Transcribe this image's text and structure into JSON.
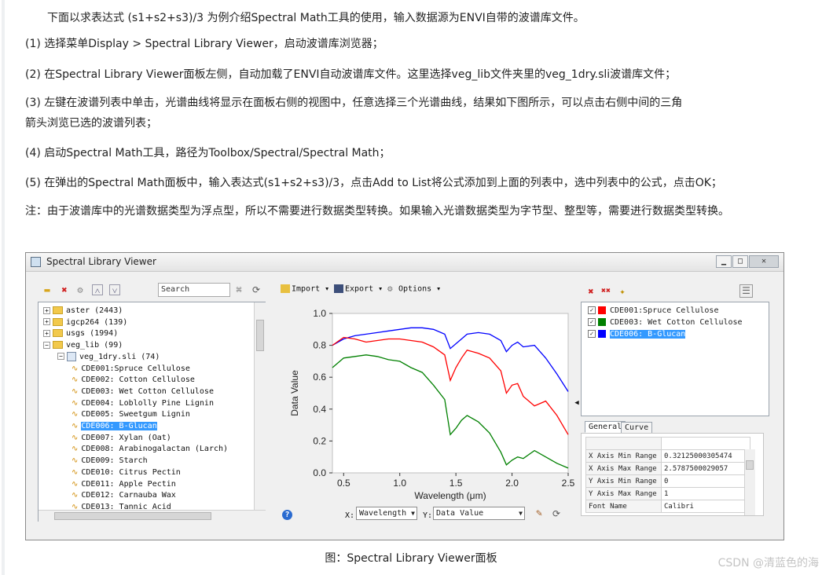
{
  "doc": {
    "intro": "下面以求表达式 (s1+s2+s3)/3 为例介绍Spectral Math工具的使用，输入数据源为ENVI自带的波谱库文件。",
    "step1": "(1) 选择菜单Display > Spectral Library Viewer，启动波谱库浏览器；",
    "step2": "(2) 在Spectral Library Viewer面板左侧，自动加载了ENVI自动波谱库文件。这里选择veg_lib文件夹里的veg_1dry.sli波谱库文件；",
    "step3a": "(3) 左键在波谱列表中单击，光谱曲线将显示在面板右侧的视图中，任意选择三个光谱曲线，结果如下图所示，可以点击右侧中间的三角",
    "step3b": "箭头浏览已选的波谱列表；",
    "step4": "(4) 启动Spectral Math工具，路径为Toolbox/Spectral/Spectral Math；",
    "step5": "(5) 在弹出的Spectral Math面板中，输入表达式(s1+s2+s3)/3，点击Add to List将公式添加到上面的列表中，选中列表中的公式，点击OK；",
    "note": "注：由于波谱库中的光谱数据类型为浮点型，所以不需要进行数据类型转换。如果输入光谱数据类型为字节型、整型等，需要进行数据类型转换。",
    "caption": "图：Spectral Library Viewer面板",
    "watermark": "CSDN @清蓝色的海"
  },
  "window": {
    "title": "Spectral Library Viewer",
    "search_placeholder": "Search",
    "tree": [
      {
        "label": "aster  (2443)",
        "level": 0,
        "type": "folder",
        "expander": "+"
      },
      {
        "label": "igcp264  (139)",
        "level": 0,
        "type": "folder",
        "expander": "+"
      },
      {
        "label": "usgs  (1994)",
        "level": 0,
        "type": "folder",
        "expander": "+"
      },
      {
        "label": "veg_lib  (99)",
        "level": 0,
        "type": "folder",
        "expander": "−"
      },
      {
        "label": "veg_1dry.sli  (74)",
        "level": 1,
        "type": "speclib",
        "expander": "−"
      },
      {
        "label": "CDE001:Spruce Cellulose",
        "level": 2,
        "type": "spectrum"
      },
      {
        "label": "CDE002: Cotton Cellulose",
        "level": 2,
        "type": "spectrum"
      },
      {
        "label": "CDE003: Wet Cotton Cellulose",
        "level": 2,
        "type": "spectrum"
      },
      {
        "label": "CDE004: Loblolly Pine Lignin",
        "level": 2,
        "type": "spectrum"
      },
      {
        "label": "CDE005: Sweetgum Lignin",
        "level": 2,
        "type": "spectrum"
      },
      {
        "label": "CDE006: B-Glucan",
        "level": 2,
        "type": "spectrum",
        "selected": true
      },
      {
        "label": "CDE007: Xylan (Oat)",
        "level": 2,
        "type": "spectrum"
      },
      {
        "label": "CDE008: Arabinogalactan (Larch)",
        "level": 2,
        "type": "spectrum"
      },
      {
        "label": "CDE009: Starch",
        "level": 2,
        "type": "spectrum"
      },
      {
        "label": "CDE010: Citrus Pectin",
        "level": 2,
        "type": "spectrum"
      },
      {
        "label": "CDE011: Apple Pectin",
        "level": 2,
        "type": "spectrum"
      },
      {
        "label": "CDE012: Carnauba Wax",
        "level": 2,
        "type": "spectrum"
      },
      {
        "label": "CDE013: Tannic Acid",
        "level": 2,
        "type": "spectrum"
      }
    ],
    "menus": {
      "import": "Import",
      "export": "Export",
      "options": "Options"
    },
    "x_label": "X:",
    "x_value": "Wavelength",
    "y_label": "Y:",
    "y_value": "Data Value",
    "legend": [
      {
        "label": "CDE001:Spruce Cellulose",
        "color": "#ff0000"
      },
      {
        "label": "CDE003: Wet Cotton Cellulose",
        "color": "#008000"
      },
      {
        "label": "CDE006: B-Glucan",
        "color": "#0000ff",
        "selected": true
      }
    ],
    "tabs": {
      "general": "General",
      "curve": "Curve"
    },
    "properties": [
      {
        "key": "X Axis Min Range",
        "value": "0.32125000305474"
      },
      {
        "key": "X Axis Max Range",
        "value": "2.5787500029057"
      },
      {
        "key": "Y Axis Min Range",
        "value": "0"
      },
      {
        "key": "Y Axis Max Range",
        "value": "1"
      },
      {
        "key": "Font Name",
        "value": "Calibri"
      }
    ]
  },
  "chart_data": {
    "type": "line",
    "xlabel": "Wavelength (μm)",
    "ylabel": "Data Value",
    "xlim": [
      0.4,
      2.5
    ],
    "ylim": [
      0.0,
      1.0
    ],
    "xticks": [
      "0.5",
      "1.0",
      "1.5",
      "2.0",
      "2.5"
    ],
    "yticks": [
      "0.0",
      "0.2",
      "0.4",
      "0.6",
      "0.8",
      "1.0"
    ],
    "grid": false,
    "series": [
      {
        "color": "#0000ff",
        "x": [
          0.4,
          0.5,
          0.6,
          0.7,
          0.8,
          0.9,
          1.0,
          1.1,
          1.2,
          1.3,
          1.4,
          1.45,
          1.5,
          1.55,
          1.6,
          1.7,
          1.8,
          1.9,
          1.95,
          2.0,
          2.05,
          2.1,
          2.2,
          2.3,
          2.4,
          2.5
        ],
        "y": [
          0.8,
          0.84,
          0.86,
          0.87,
          0.88,
          0.89,
          0.9,
          0.91,
          0.91,
          0.9,
          0.87,
          0.78,
          0.81,
          0.84,
          0.87,
          0.88,
          0.87,
          0.83,
          0.76,
          0.8,
          0.82,
          0.79,
          0.8,
          0.72,
          0.62,
          0.51
        ]
      },
      {
        "color": "#ff0000",
        "x": [
          0.4,
          0.5,
          0.6,
          0.7,
          0.8,
          0.9,
          1.0,
          1.1,
          1.2,
          1.3,
          1.4,
          1.45,
          1.5,
          1.55,
          1.6,
          1.7,
          1.8,
          1.9,
          1.95,
          2.0,
          2.05,
          2.1,
          2.2,
          2.3,
          2.4,
          2.5
        ],
        "y": [
          0.8,
          0.85,
          0.84,
          0.82,
          0.83,
          0.84,
          0.84,
          0.83,
          0.82,
          0.79,
          0.74,
          0.58,
          0.66,
          0.72,
          0.77,
          0.75,
          0.72,
          0.64,
          0.5,
          0.55,
          0.56,
          0.48,
          0.42,
          0.45,
          0.36,
          0.24
        ]
      },
      {
        "color": "#008000",
        "x": [
          0.4,
          0.5,
          0.6,
          0.7,
          0.8,
          0.9,
          1.0,
          1.1,
          1.2,
          1.3,
          1.4,
          1.45,
          1.5,
          1.55,
          1.6,
          1.7,
          1.8,
          1.9,
          1.95,
          2.0,
          2.05,
          2.1,
          2.2,
          2.3,
          2.4,
          2.5
        ],
        "y": [
          0.66,
          0.72,
          0.73,
          0.74,
          0.73,
          0.71,
          0.7,
          0.66,
          0.63,
          0.55,
          0.46,
          0.24,
          0.28,
          0.33,
          0.36,
          0.32,
          0.25,
          0.13,
          0.05,
          0.08,
          0.1,
          0.09,
          0.14,
          0.1,
          0.06,
          0.03
        ]
      }
    ]
  }
}
